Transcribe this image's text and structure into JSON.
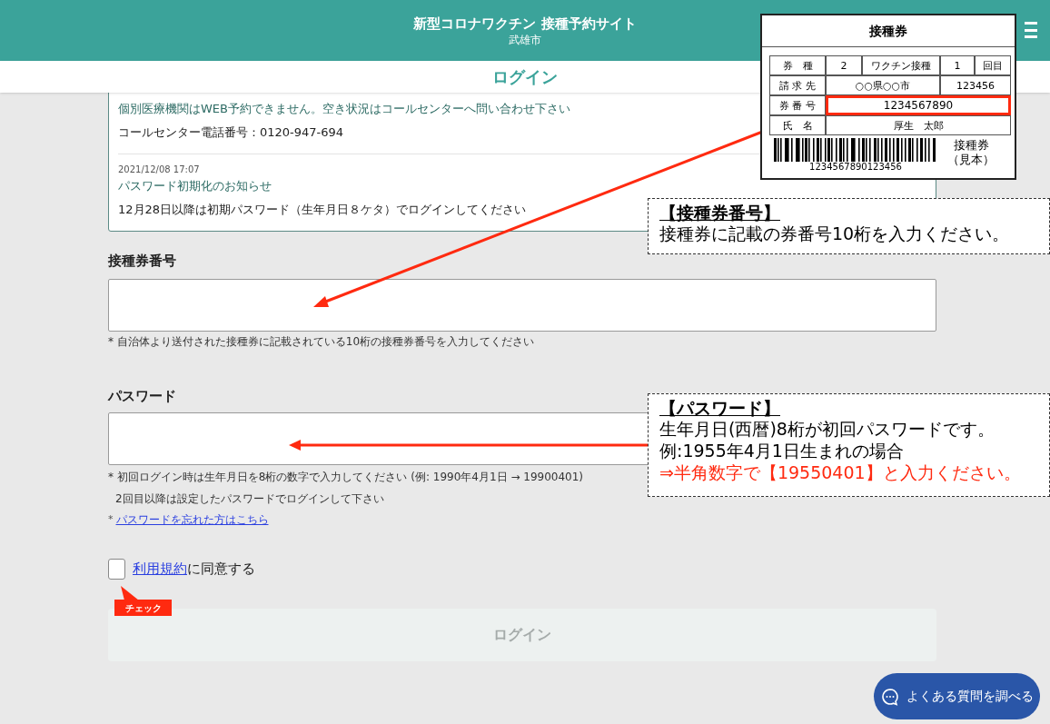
{
  "header": {
    "title": "新型コロナワクチン 接種予約サイト",
    "subtitle": "武雄市"
  },
  "page_title": "ログイン",
  "notices": [
    {
      "title": "個別医療機関はWEB予約できません。空き状況はコールセンターへ問い合わせ下さい",
      "body": "コールセンター電話番号：0120-947-694"
    },
    {
      "date": "2021/12/08 17:07",
      "title": "パスワード初期化のお知らせ",
      "body": "12月28日以降は初期パスワード（生年月日８ケタ）でログインしてください"
    }
  ],
  "form": {
    "ticket_number": {
      "label": "接種券番号",
      "hint": "* 自治体より送付された接種券に記載されている10桁の接種券番号を入力してください"
    },
    "password": {
      "label": "パスワード",
      "hints": [
        "* 初回ログイン時は生年月日を8桁の数字で入力してください (例: 1990年4月1日 → 19900401)",
        "2回目以降は設定したパスワードでログインして下さい"
      ],
      "forgot_prefix": "*",
      "forgot_link": "パスワードを忘れた方はこちら"
    },
    "terms": {
      "checked": false,
      "link": "利用規約",
      "text": "に同意する"
    },
    "login_button": {
      "label": "ログイン",
      "disabled": true
    }
  },
  "faq_button": "よくある質問を調べる",
  "annotations": {
    "ticket_sample": {
      "title": "接種券",
      "row_1": [
        "券　種",
        "2",
        "ワクチン接種",
        "1",
        "回目"
      ],
      "row_2": [
        "請 求 先",
        "○○県○○市",
        "123456"
      ],
      "row_3": [
        "券 番 号",
        "1234567890"
      ],
      "row_4": [
        "氏　名",
        "厚生　太郎"
      ],
      "barcode_number": "1234567890123456",
      "caption": [
        "接種券",
        "（見本）"
      ]
    },
    "ticket_callout": {
      "heading": "【接種券番号】",
      "lines": [
        {
          "text": "接種券に記載の券番号10桁を入力ください。",
          "kind": "normal"
        }
      ]
    },
    "password_callout": {
      "heading": "【パスワード】",
      "lines": [
        {
          "text": "生年月日(西暦)8桁が初回パスワードです。",
          "kind": "normal"
        },
        {
          "text": "例:1955年4月1日生まれの場合",
          "kind": "normal"
        },
        {
          "text": "⇒半角数字で【19550401】と入力ください。",
          "kind": "emphasis"
        }
      ]
    },
    "check_tag": "チェック"
  }
}
